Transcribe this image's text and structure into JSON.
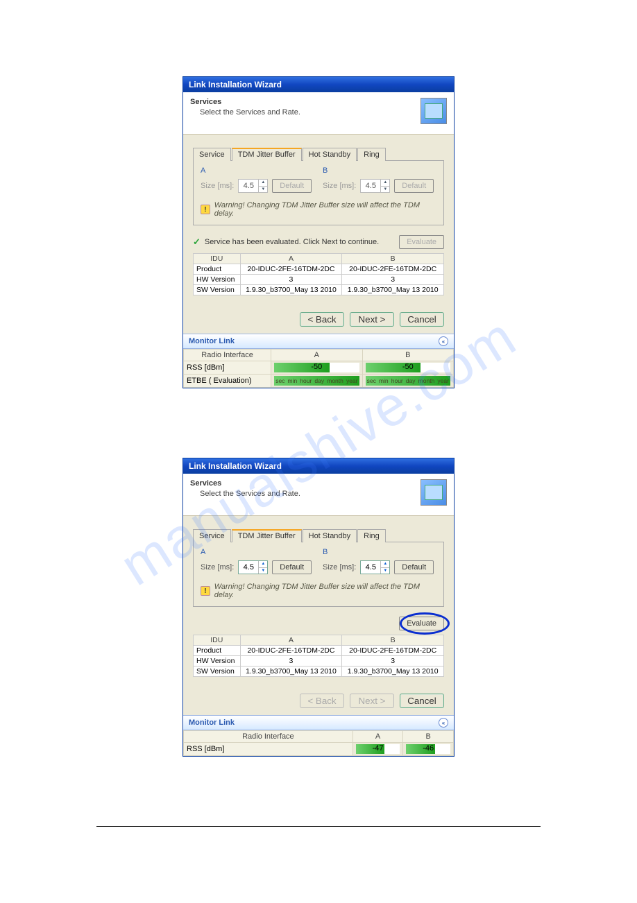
{
  "watermark": "manualshive.com",
  "wizard1": {
    "title": "Link Installation Wizard",
    "headerTitle": "Services",
    "headerSub": "Select the Services and Rate.",
    "tabs": {
      "t0": "Service",
      "t1": "TDM Jitter Buffer",
      "t2": "Hot Standby",
      "t3": "Ring"
    },
    "labelA": "A",
    "labelB": "B",
    "sizeLabel": "Size [ms]:",
    "sizeA": "4.5",
    "sizeB": "4.5",
    "defaultBtn": "Default",
    "warning": "Warning! Changing TDM Jitter Buffer size will affect the TDM delay.",
    "evalMsg": "Service has been evaluated. Click Next to continue.",
    "evaluateBtn": "Evaluate",
    "idu": {
      "h0": "IDU",
      "h1": "A",
      "h2": "B",
      "r0c0": "Product",
      "r0c1": "20-IDUC-2FE-16TDM-2DC",
      "r0c2": "20-IDUC-2FE-16TDM-2DC",
      "r1c0": "HW Version",
      "r1c1": "3",
      "r1c2": "3",
      "r2c0": "SW Version",
      "r2c1": "1.9.30_b3700_May 13 2010",
      "r2c2": "1.9.30_b3700_May 13 2010"
    },
    "back": "< Back",
    "next": "Next >",
    "cancel": "Cancel",
    "monitor": "Monitor Link",
    "radioIf": "Radio Interface",
    "colA": "A",
    "colB": "B",
    "rssLbl": "RSS [dBm]",
    "rssA": "-50",
    "rssB": "-50",
    "etbeLbl": "ETBE ( Evaluation)",
    "ticks": {
      "t0": "sec",
      "t1": "min",
      "t2": "hour",
      "t3": "day",
      "t4": "month",
      "t5": "year"
    }
  },
  "wizard2": {
    "title": "Link Installation Wizard",
    "headerTitle": "Services",
    "headerSub": "Select the Services and Rate.",
    "tabs": {
      "t0": "Service",
      "t1": "TDM Jitter Buffer",
      "t2": "Hot Standby",
      "t3": "Ring"
    },
    "labelA": "A",
    "labelB": "B",
    "sizeLabel": "Size [ms]:",
    "sizeA": "4.5",
    "sizeB": "4.5",
    "defaultBtn": "Default",
    "warning": "Warning! Changing TDM Jitter Buffer size will affect the TDM delay.",
    "evaluateBtn": "Evaluate",
    "idu": {
      "h0": "IDU",
      "h1": "A",
      "h2": "B",
      "r0c0": "Product",
      "r0c1": "20-IDUC-2FE-16TDM-2DC",
      "r0c2": "20-IDUC-2FE-16TDM-2DC",
      "r1c0": "HW Version",
      "r1c1": "3",
      "r1c2": "3",
      "r2c0": "SW Version",
      "r2c1": "1.9.30_b3700_May 13 2010",
      "r2c2": "1.9.30_b3700_May 13 2010"
    },
    "back": "< Back",
    "next": "Next >",
    "cancel": "Cancel",
    "monitor": "Monitor Link",
    "radioIf": "Radio Interface",
    "colA": "A",
    "colB": "B",
    "rssLbl": "RSS [dBm]",
    "rssA": "-47",
    "rssB": "-46"
  }
}
